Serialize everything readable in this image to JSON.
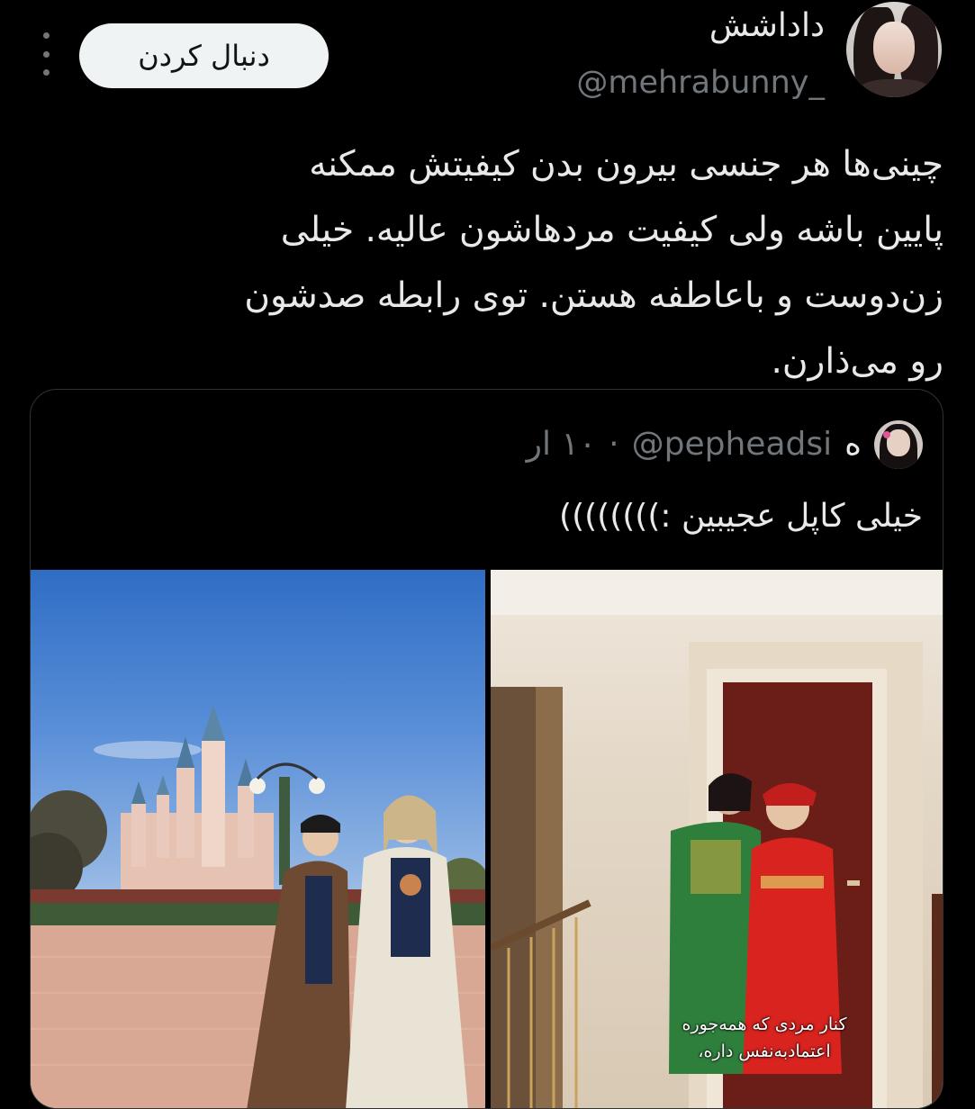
{
  "post": {
    "display_name": "داداشش",
    "handle": "@mehrabunny_",
    "follow_label": "دنبال کردن",
    "text_lines": [
      "چینی‌ها هر جنسی بیرون بدن کیفیتش ممکنه",
      "پایین باشه ولی کیفیت مردهاشون عالیه. خیلی",
      "زن‌دوست و باعاطفه هستن. توی رابطه صدشون",
      "رو می‌ذارن."
    ]
  },
  "quote": {
    "name": "ه",
    "handle": "@pepheadsi",
    "separator": "·",
    "time": "۱۰ ار",
    "text": "خیلی کاپل عجیبین :))))))))",
    "caption_lines": [
      "کنار مردی که همه‌جوره",
      "اعتماد‌به‌نفس داره،"
    ]
  },
  "icons": {
    "more": "more-vertical-icon"
  },
  "colors": {
    "background": "#000000",
    "text": "#e7e9ea",
    "muted": "#71767b",
    "button_bg": "#eff3f4",
    "border": "#2f3336"
  }
}
